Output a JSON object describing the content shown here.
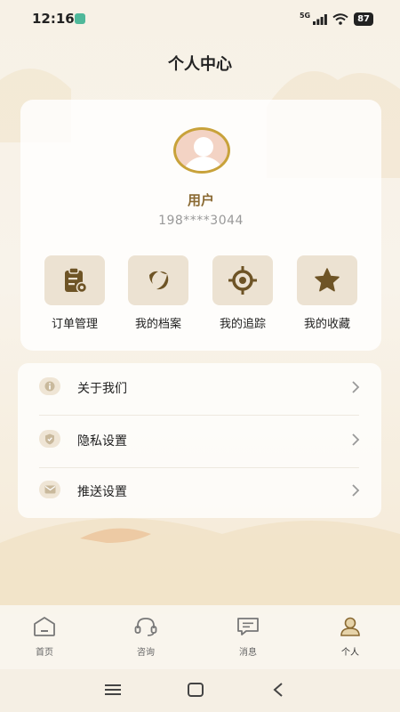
{
  "status_bar": {
    "time": "12:16",
    "network": "5G",
    "battery": "87"
  },
  "header": {
    "title": "个人中心"
  },
  "profile": {
    "name": "用户",
    "phone": "198****3044"
  },
  "quick_actions": [
    {
      "label": "订单管理",
      "icon": "order-clipboard-icon"
    },
    {
      "label": "我的档案",
      "icon": "archive-swirl-icon"
    },
    {
      "label": "我的追踪",
      "icon": "target-tracking-icon"
    },
    {
      "label": "我的收藏",
      "icon": "star-icon"
    }
  ],
  "menu": [
    {
      "label": "关于我们",
      "icon": "info-icon"
    },
    {
      "label": "隐私设置",
      "icon": "shield-icon"
    },
    {
      "label": "推送设置",
      "icon": "mail-icon"
    }
  ],
  "tabs": [
    {
      "label": "首页",
      "icon": "home-icon",
      "active": false
    },
    {
      "label": "咨询",
      "icon": "headset-icon",
      "active": false
    },
    {
      "label": "消息",
      "icon": "message-icon",
      "active": false
    },
    {
      "label": "个人",
      "icon": "user-icon",
      "active": true
    }
  ],
  "colors": {
    "accent": "#8a6a33",
    "tile_bg": "#ece2d2",
    "icon_brown": "#6e5426",
    "avatar_ring": "#c8a23a"
  }
}
